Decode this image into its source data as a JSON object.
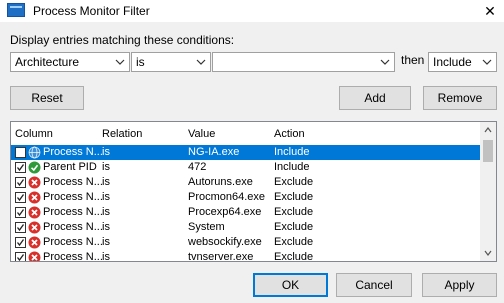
{
  "window": {
    "title": "Process Monitor Filter",
    "close_glyph": "✕"
  },
  "condition_label": "Display entries matching these conditions:",
  "filter": {
    "column_value": "Architecture",
    "relation_value": "is",
    "value_text": "",
    "then_label": "then",
    "action_value": "Include"
  },
  "buttons": {
    "reset": "Reset",
    "add": "Add",
    "remove": "Remove",
    "ok": "OK",
    "cancel": "Cancel",
    "apply": "Apply"
  },
  "list": {
    "headers": {
      "column": "Column",
      "relation": "Relation",
      "value": "Value",
      "action": "Action"
    },
    "rows": [
      {
        "checked": false,
        "icon": "globe-icon",
        "column": "Process N...",
        "relation": "is",
        "value": "NG-IA.exe",
        "action": "Include",
        "selected": true
      },
      {
        "checked": true,
        "icon": "include-check-icon",
        "column": "Parent PID",
        "relation": "is",
        "value": "472",
        "action": "Include",
        "selected": false
      },
      {
        "checked": true,
        "icon": "exclude-x-icon",
        "column": "Process N...",
        "relation": "is",
        "value": "Autoruns.exe",
        "action": "Exclude",
        "selected": false
      },
      {
        "checked": true,
        "icon": "exclude-x-icon",
        "column": "Process N...",
        "relation": "is",
        "value": "Procmon64.exe",
        "action": "Exclude",
        "selected": false
      },
      {
        "checked": true,
        "icon": "exclude-x-icon",
        "column": "Process N...",
        "relation": "is",
        "value": "Procexp64.exe",
        "action": "Exclude",
        "selected": false
      },
      {
        "checked": true,
        "icon": "exclude-x-icon",
        "column": "Process N...",
        "relation": "is",
        "value": "System",
        "action": "Exclude",
        "selected": false
      },
      {
        "checked": true,
        "icon": "exclude-x-icon",
        "column": "Process N...",
        "relation": "is",
        "value": "websockify.exe",
        "action": "Exclude",
        "selected": false
      },
      {
        "checked": true,
        "icon": "exclude-x-icon",
        "column": "Process N...",
        "relation": "is",
        "value": "tvnserver.exe",
        "action": "Exclude",
        "selected": false
      }
    ]
  },
  "colors": {
    "selection": "#0078d7",
    "include_icon": "#2e9a3a",
    "exclude_icon": "#d9302c",
    "globe_icon": "#3b8fd6"
  }
}
